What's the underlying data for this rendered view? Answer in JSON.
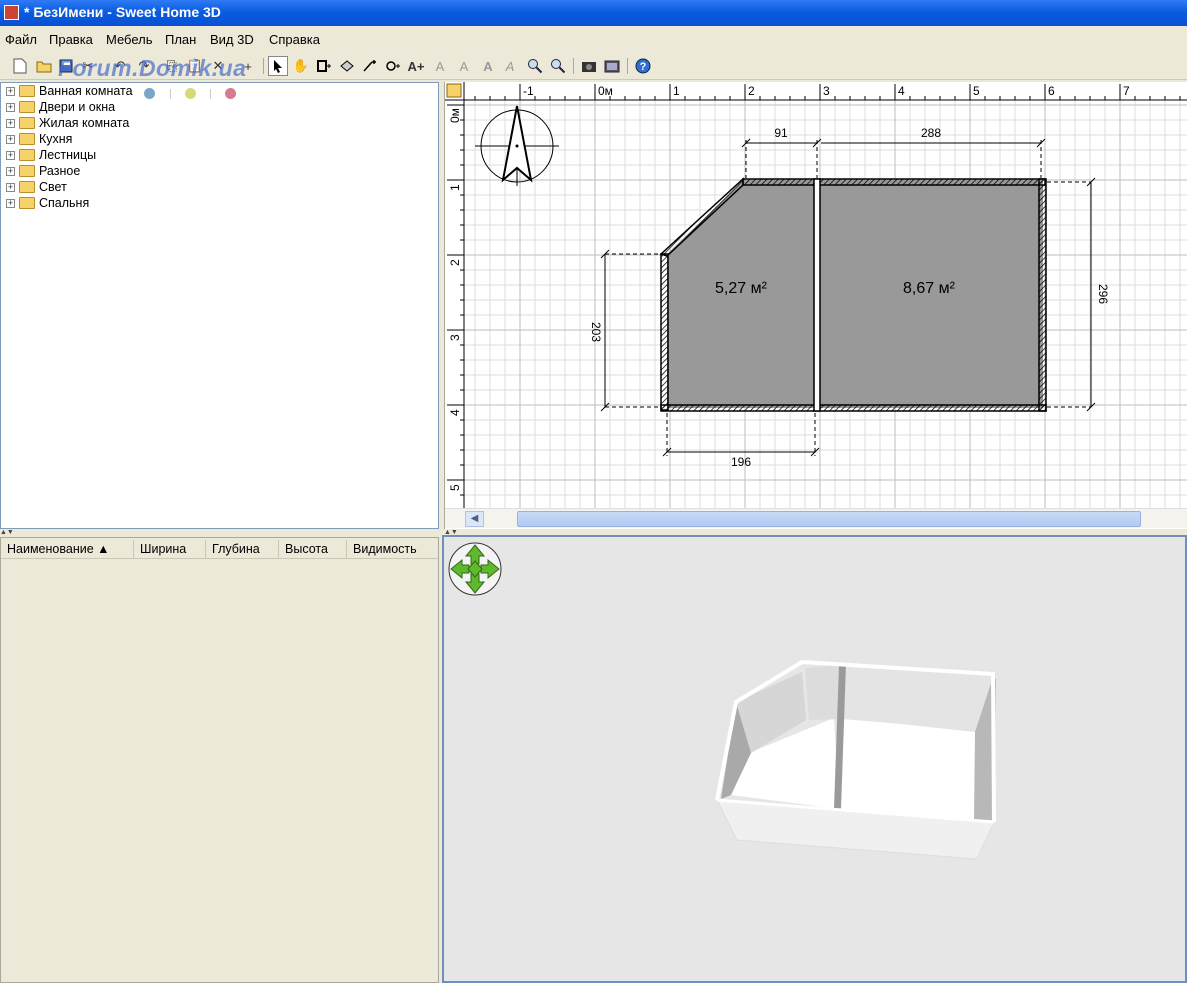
{
  "window": {
    "title": "* БезИмени - Sweet Home 3D"
  },
  "watermark": "Forum.Domik.ua",
  "menu": [
    "Файл",
    "Правка",
    "Мебель",
    "План",
    "Вид 3D",
    "Справка"
  ],
  "toolbar": {
    "icons": [
      "new-icon",
      "open-icon",
      "save-icon",
      "cut-icon",
      "undo-icon",
      "redo-icon",
      "copy-icon",
      "paste-icon",
      "delete-icon",
      "add-furniture-icon",
      "select-icon",
      "pan-icon",
      "create-walls-icon",
      "create-rooms-icon",
      "create-dimensions-icon",
      "create-labels-icon",
      "add-text-icon",
      "text-style-icon",
      "bold-icon",
      "italic-icon",
      "zoom-in-icon",
      "zoom-out-icon",
      "create-photo-icon",
      "create-video-icon",
      "help-icon"
    ]
  },
  "catalog": {
    "categories": [
      "Ванная комната",
      "Двери и окна",
      "Жилая комната",
      "Кухня",
      "Лестницы",
      "Разное",
      "Свет",
      "Спальня"
    ],
    "colors": {
      "blue": "#7aa6c8",
      "yellow": "#d6d97b",
      "red": "#d87b8f"
    }
  },
  "furniture_table": {
    "columns": [
      "Наименование ▲",
      "Ширина",
      "Глубина",
      "Высота",
      "Видимость"
    ]
  },
  "plan": {
    "ruler_x_labels": [
      "-1",
      "0м",
      "1",
      "2",
      "3",
      "4",
      "5",
      "6",
      "7"
    ],
    "ruler_y_labels": [
      "0м",
      "1",
      "2",
      "3",
      "4",
      "5"
    ],
    "rooms": [
      {
        "area": "5,27 м²"
      },
      {
        "area": "8,67 м²"
      }
    ],
    "dimensions": [
      "91",
      "288",
      "296",
      "203",
      "196"
    ]
  },
  "colors": {
    "titlebar": "#0a5ce0",
    "room_fill": "#999999",
    "grid": "#d4d4d4",
    "nav_green": "#5fb82e"
  }
}
